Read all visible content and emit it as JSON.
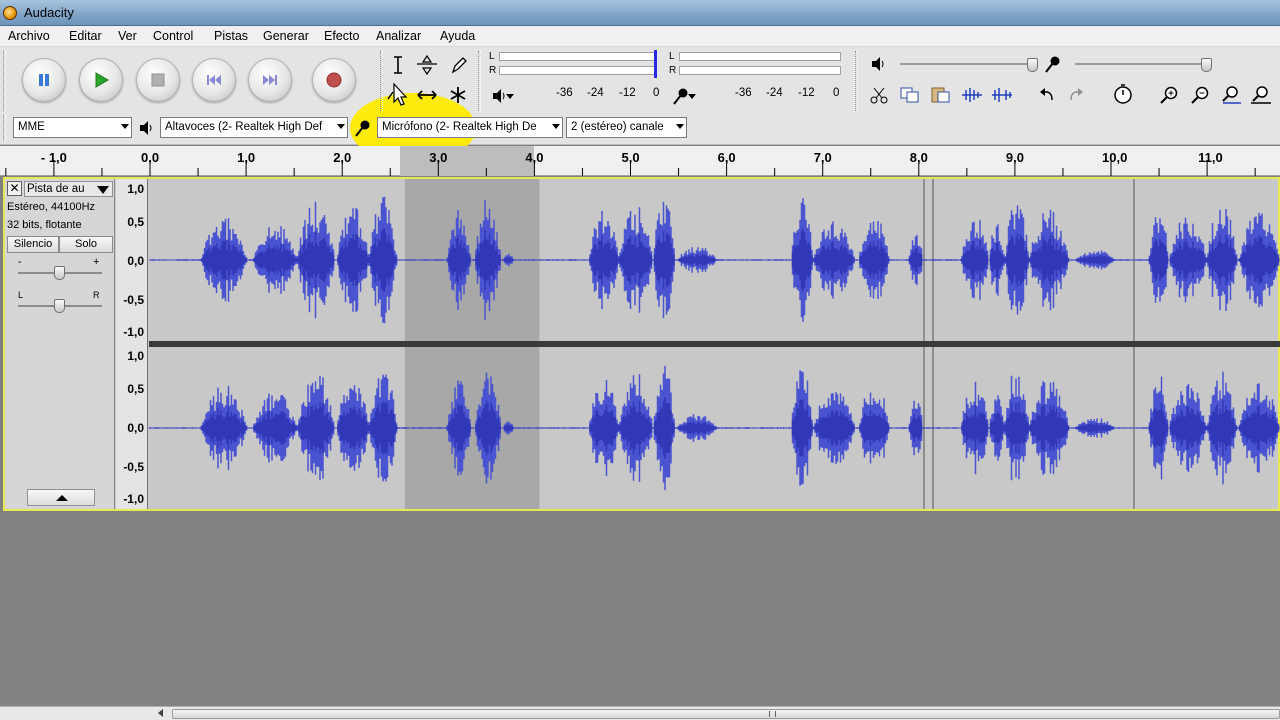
{
  "window": {
    "title": "Audacity"
  },
  "menu": [
    "Archivo",
    "Editar",
    "Ver",
    "Control",
    "Pistas",
    "Generar",
    "Efecto",
    "Analizar",
    "Ayuda"
  ],
  "meters": {
    "left_label": "L",
    "right_label": "R",
    "playback_scale": [
      "-36",
      "-24",
      "-12",
      "0"
    ],
    "record_scale": [
      "-36",
      "-24",
      "-12",
      "0"
    ]
  },
  "devices": {
    "host": "MME",
    "output": "Altavoces (2- Realtek High Def",
    "input": "Micrófono (2- Realtek High De",
    "channels": "2 (estéreo) canale"
  },
  "ruler": {
    "labels": [
      "- 1,0",
      "0,0",
      "1,0",
      "2,0",
      "3,0",
      "4,0",
      "5,0",
      "6,0",
      "7,0",
      "8,0",
      "9,0",
      "10,0",
      "11,0"
    ],
    "selection_seconds": [
      2.6,
      4.0
    ]
  },
  "track": {
    "name": "Pista de au",
    "info_rate": "Estéreo, 44100Hz",
    "info_format": "32 bits, flotante",
    "mute_label": "Silencio",
    "solo_label": "Solo",
    "gain_minus": "-",
    "gain_plus": "+",
    "pan_left": "L",
    "pan_right": "R",
    "vruler": [
      "1,0",
      "0,5",
      "0,0",
      "-0,5",
      "-1,0"
    ]
  },
  "colors": {
    "waveform": "#4b54d0",
    "waveform_rms": "#3138b8",
    "highlight": "#ffeb00",
    "selection": "#a8a8a8"
  }
}
